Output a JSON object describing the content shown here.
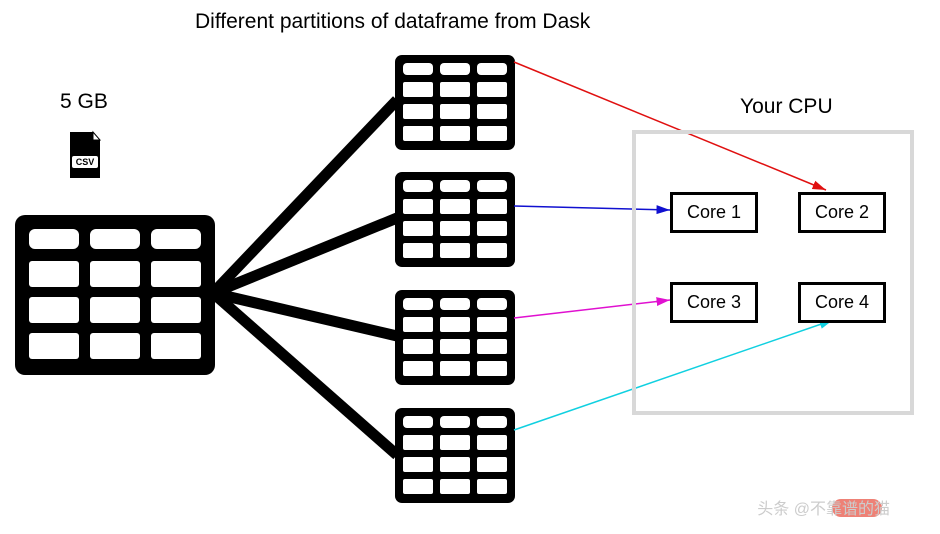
{
  "title": "Different partitions of dataframe from Dask",
  "file_size": "5 GB",
  "file_type": "CSV",
  "cpu": {
    "label": "Your CPU",
    "cores": [
      "Core 1",
      "Core 2",
      "Core 3",
      "Core 4"
    ]
  },
  "arrows": {
    "colors": [
      "#e01010",
      "#1010d0",
      "#e010d0",
      "#10d0e0"
    ]
  },
  "watermark": "头条 @不靠谱的猫"
}
